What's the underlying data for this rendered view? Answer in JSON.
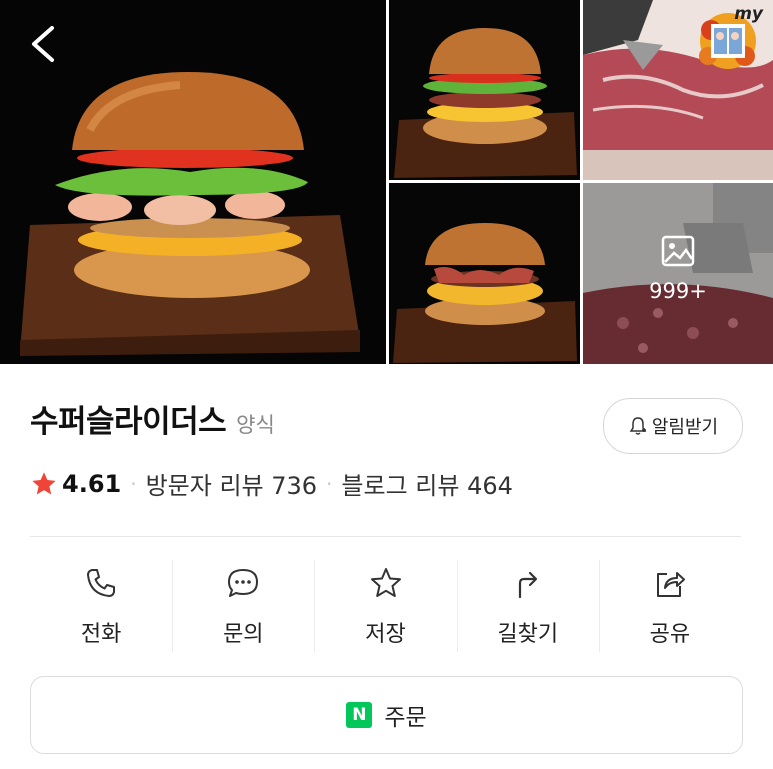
{
  "header": {
    "back_icon": "chevron-left-icon"
  },
  "gallery": {
    "photos": [
      "shrimp-burger-photo",
      "bacon-cheese-burger-photo",
      "raw-beef-photo",
      "bacon-double-burger-photo",
      "meat-grinder-photo"
    ],
    "more_count": "999+",
    "badge_text": "my"
  },
  "place": {
    "name": "수퍼슬라이더스",
    "category": "양식",
    "alarm_label": "알림받기",
    "rating": "4.61",
    "visitor_reviews": "방문자 리뷰 736",
    "blog_reviews": "블로그 리뷰 464"
  },
  "actions": [
    {
      "label": "전화",
      "icon": "phone-icon"
    },
    {
      "label": "문의",
      "icon": "chat-icon"
    },
    {
      "label": "저장",
      "icon": "star-outline-icon"
    },
    {
      "label": "길찾기",
      "icon": "directions-icon"
    },
    {
      "label": "공유",
      "icon": "share-icon"
    }
  ],
  "order": {
    "logo": "N",
    "label": "주문"
  },
  "colors": {
    "star": "#f04438",
    "naver_green": "#03c75a"
  }
}
